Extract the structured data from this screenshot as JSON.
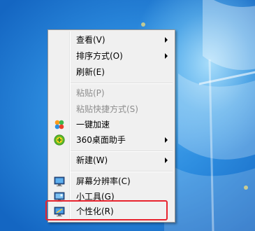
{
  "menu": {
    "items": [
      {
        "label": "查看(V)",
        "submenu": true,
        "enabled": true,
        "icon": null
      },
      {
        "label": "排序方式(O)",
        "submenu": true,
        "enabled": true,
        "icon": null
      },
      {
        "label": "刷新(E)",
        "submenu": false,
        "enabled": true,
        "icon": null
      },
      {
        "label": "粘贴(P)",
        "submenu": false,
        "enabled": false,
        "icon": null
      },
      {
        "label": "粘贴快捷方式(S)",
        "submenu": false,
        "enabled": false,
        "icon": null
      },
      {
        "label": "一键加速",
        "submenu": false,
        "enabled": true,
        "icon": "speedup-icon"
      },
      {
        "label": "360桌面助手",
        "submenu": true,
        "enabled": true,
        "icon": "360-desktop-icon"
      },
      {
        "label": "新建(W)",
        "submenu": true,
        "enabled": true,
        "icon": null
      },
      {
        "label": "屏幕分辨率(C)",
        "submenu": false,
        "enabled": true,
        "icon": "screen-resolution-icon"
      },
      {
        "label": "小工具(G)",
        "submenu": false,
        "enabled": true,
        "icon": "gadgets-icon"
      },
      {
        "label": "个性化(R)",
        "submenu": false,
        "enabled": true,
        "icon": "personalize-icon"
      }
    ]
  },
  "colors": {
    "highlight_border": "#e8232e",
    "menu_background": "#f0f0f0",
    "disabled_text": "#8d8d8d"
  }
}
